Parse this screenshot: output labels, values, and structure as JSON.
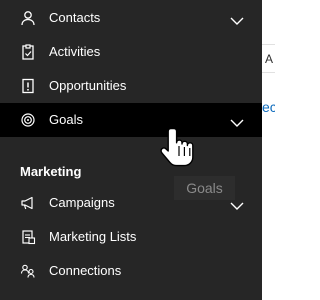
{
  "sitemap": {
    "items": [
      {
        "label": "Contacts",
        "icon": "person-icon",
        "has_chevron": true
      },
      {
        "label": "Activities",
        "icon": "clipboard-icon",
        "has_chevron": false
      },
      {
        "label": "Opportunities",
        "icon": "alert-document-icon",
        "has_chevron": false
      },
      {
        "label": "Goals",
        "icon": "target-icon",
        "has_chevron": true,
        "selected": true
      }
    ],
    "section_title": "Marketing",
    "marketing_items": [
      {
        "label": "Campaigns",
        "icon": "megaphone-icon",
        "has_chevron": true
      },
      {
        "label": "Marketing Lists",
        "icon": "list-icon",
        "has_chevron": false
      },
      {
        "label": "Connections",
        "icon": "connections-icon",
        "has_chevron": false
      }
    ]
  },
  "tooltip": {
    "text": "Goals"
  },
  "right_edge": {
    "top_glyph": "A",
    "link_fragment": "ec"
  },
  "colors": {
    "nav_bg": "#262626",
    "selected_bg": "#000000",
    "link": "#0f6cbd"
  }
}
